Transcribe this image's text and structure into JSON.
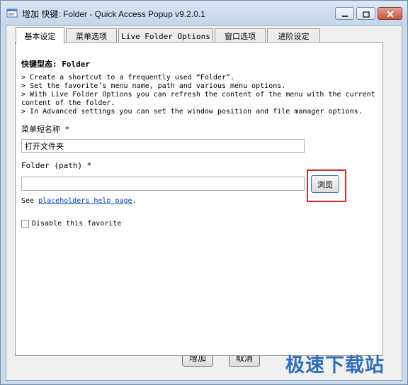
{
  "window": {
    "title": "增加 快键: Folder - Quick Access Popup v9.2.0.1",
    "controls": {
      "minimize": "minimize-icon",
      "maximize": "maximize-icon",
      "close": "close-icon"
    }
  },
  "tabs": [
    {
      "label": "基本设定",
      "active": true
    },
    {
      "label": "菜单选项",
      "active": false
    },
    {
      "label": "Live Folder Options",
      "active": false
    },
    {
      "label": "窗口选项",
      "active": false
    },
    {
      "label": "进阶设定",
      "active": false
    }
  ],
  "form": {
    "heading": "快键型态: Folder",
    "description": [
      "> Create a shortcut to a frequently used “Folder”.",
      "> Set the favorite’s menu name, path and various menu options.",
      "> With Live Folder Options you can refresh the content of the menu with the current content of the folder.",
      "> In Advanced settings you can set the window position and file manager options."
    ],
    "menu_name_label": "菜单短名称 *",
    "menu_name_value": "打开文件夹",
    "folder_path_label": "Folder (path) *",
    "folder_path_value": "",
    "browse_label": "浏览",
    "see_prefix": "See ",
    "see_link": "placeholders help page",
    "see_suffix": ".",
    "disable_label": "Disable this favorite",
    "disable_checked": false
  },
  "footer": {
    "add_label": "增加",
    "cancel_label": "取消"
  },
  "watermark": "极速下载站",
  "colors": {
    "highlight": "#e0262b",
    "link": "#0645ad",
    "watermark": "#2f6fb8"
  }
}
